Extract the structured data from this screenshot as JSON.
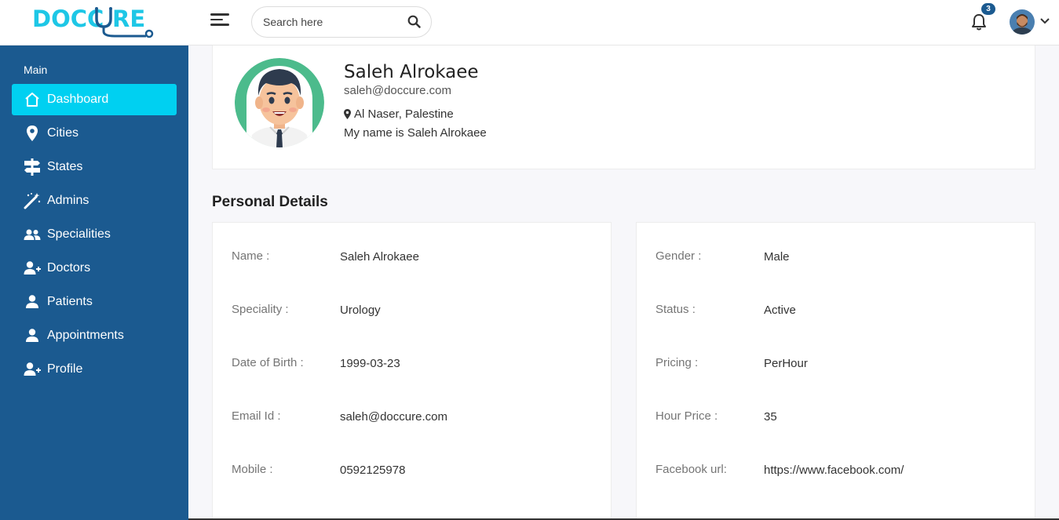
{
  "header": {
    "logo_text": "DOCCURE",
    "search_placeholder": "Search here",
    "notification_count": "3"
  },
  "sidebar": {
    "section_title": "Main",
    "items": [
      {
        "label": "Dashboard",
        "icon": "home-icon",
        "active": true
      },
      {
        "label": "Cities",
        "icon": "map-pin-icon",
        "active": false
      },
      {
        "label": "States",
        "icon": "signpost-icon",
        "active": false
      },
      {
        "label": "Admins",
        "icon": "magic-wand-icon",
        "active": false
      },
      {
        "label": "Specialities",
        "icon": "users-icon",
        "active": false
      },
      {
        "label": "Doctors",
        "icon": "user-plus-icon",
        "active": false
      },
      {
        "label": "Patients",
        "icon": "user-icon",
        "active": false
      },
      {
        "label": "Appointments",
        "icon": "user-icon",
        "active": false
      },
      {
        "label": "Profile",
        "icon": "user-plus-icon",
        "active": false
      }
    ]
  },
  "profile": {
    "name": "Saleh Alrokaee",
    "email": "saleh@doccure.com",
    "location": "Al Naser, Palestine",
    "about": "My name is Saleh Alrokaee"
  },
  "personal_details": {
    "title": "Personal Details",
    "left": [
      {
        "label": "Name :",
        "value": "Saleh Alrokaee"
      },
      {
        "label": "Speciality :",
        "value": "Urology"
      },
      {
        "label": "Date of Birth :",
        "value": "1999-03-23"
      },
      {
        "label": "Email Id :",
        "value": "saleh@doccure.com"
      },
      {
        "label": "Mobile :",
        "value": "0592125978"
      }
    ],
    "right": [
      {
        "label": "Gender :",
        "value": "Male"
      },
      {
        "label": "Status :",
        "value": "Active"
      },
      {
        "label": "Pricing :",
        "value": "PerHour"
      },
      {
        "label": "Hour Price :",
        "value": "35"
      },
      {
        "label": "Facebook url:",
        "value": "https://www.facebook.com/"
      }
    ]
  },
  "colors": {
    "sidebar_bg": "#1b5a90",
    "active_item": "#00d0f1",
    "logo": "#1ec7e6"
  }
}
